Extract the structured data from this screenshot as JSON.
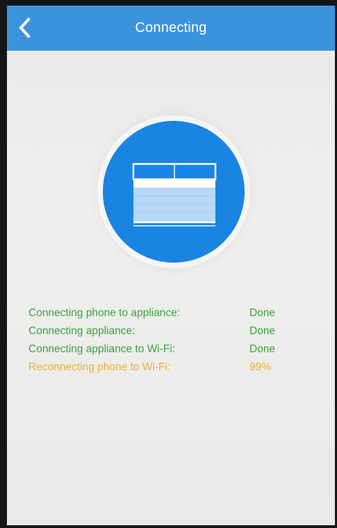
{
  "header": {
    "title": "Connecting",
    "back_icon": "chevron-left-icon"
  },
  "illustration": {
    "icon": "air-conditioner-icon"
  },
  "colors": {
    "header_bg": "#3b93de",
    "circle_bg": "#1a84e3",
    "done_text": "#39a43f",
    "progress_text": "#e5b23b"
  },
  "steps": [
    {
      "label": "Connecting phone to appliance:",
      "value": "Done",
      "state": "done"
    },
    {
      "label": "Connecting appliance:",
      "value": "Done",
      "state": "done"
    },
    {
      "label": "Connecting appliance to Wi-Fi:",
      "value": "Done",
      "state": "done"
    },
    {
      "label": "Reconnecting phone to Wi-Fi:",
      "value": "99%",
      "state": "in-progress"
    }
  ]
}
